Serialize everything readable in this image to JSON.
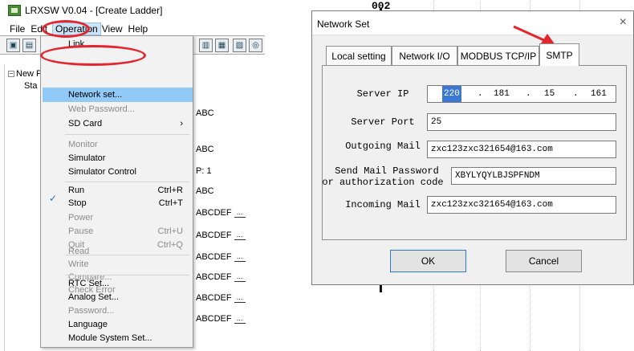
{
  "app": {
    "title": "LRXSW V0.04 - [Create Ladder]",
    "menu": [
      "File",
      "Edit",
      "Operation",
      "View",
      "Help"
    ],
    "active_menu": "Operation"
  },
  "tree": {
    "root_label": "New Pr",
    "child_label": "Sta",
    "expander": "−"
  },
  "dropdown": {
    "items": [
      {
        "label": "Link",
        "shortcut": "",
        "disabled": false
      },
      {
        "label": "Network set...",
        "shortcut": "",
        "disabled": false
      },
      {
        "label": "Web Password...",
        "shortcut": "",
        "disabled": true
      },
      {
        "label": "SD Card",
        "shortcut": "›",
        "disabled": false
      },
      {
        "label": "Monitor",
        "shortcut": "",
        "disabled": true
      },
      {
        "label": "Simulator",
        "shortcut": "",
        "disabled": false
      },
      {
        "label": "Simulator Control",
        "shortcut": "",
        "disabled": false
      },
      {
        "label": "Run",
        "shortcut": "Ctrl+R",
        "disabled": false
      },
      {
        "label": "Stop",
        "shortcut": "Ctrl+T",
        "disabled": false
      },
      {
        "label": "Power",
        "shortcut": "",
        "disabled": true
      },
      {
        "label": "Pause",
        "shortcut": "Ctrl+U",
        "disabled": true
      },
      {
        "label": "Quit",
        "shortcut": "Ctrl+Q",
        "disabled": true
      },
      {
        "label": "Read",
        "shortcut": "",
        "disabled": true
      },
      {
        "label": "Write",
        "shortcut": "",
        "disabled": true
      },
      {
        "label": "Compare...",
        "shortcut": "",
        "disabled": true
      },
      {
        "label": "Check Error",
        "shortcut": "",
        "disabled": true
      },
      {
        "label": "RTC Set...",
        "shortcut": "",
        "disabled": false
      },
      {
        "label": "Analog Set...",
        "shortcut": "",
        "disabled": false
      },
      {
        "label": "Password...",
        "shortcut": "",
        "disabled": true
      },
      {
        "label": "Language",
        "shortcut": "",
        "disabled": false
      },
      {
        "label": "Module System Set...",
        "shortcut": "",
        "disabled": false
      }
    ],
    "highlighted": "Network set...",
    "checked": "Stop",
    "check_glyph": "✓"
  },
  "ladder": {
    "texts": [
      "ABC",
      "ABC",
      "P: 1",
      "ABC",
      "ABCDEF",
      "ABCDEF",
      "ABCDEF",
      "ABCDEF",
      "ABCDEF",
      "ABCDEF"
    ],
    "ellipsis": "...",
    "rung_number": "002"
  },
  "dialog": {
    "title": "Network Set",
    "close": "×",
    "tabs": [
      "Local setting",
      "Network I/O",
      "MODBUS TCP/IP",
      "SMTP"
    ],
    "selected_tab": "SMTP",
    "fields": {
      "server_ip_label": "Server IP",
      "server_ip": [
        "220",
        "181",
        "15",
        "161"
      ],
      "server_port_label": "Server Port",
      "server_port": "25",
      "outgoing_mail_label": "Outgoing Mail",
      "outgoing_mail": "zxc123zxc321654@163.com",
      "password_label_1": "Send Mail Password",
      "password_label_2": "or authorization code",
      "password": "XBYLYQYLBJSPFNDM",
      "incoming_mail_label": "Incoming Mail",
      "incoming_mail": "zxc123zxc321654@163.com"
    },
    "ok_label": "OK",
    "cancel_label": "Cancel"
  },
  "colors": {
    "annotation_red": "#e3262d",
    "menu_highlight": "#91c9f7",
    "ip_selection": "#3b78d4"
  }
}
